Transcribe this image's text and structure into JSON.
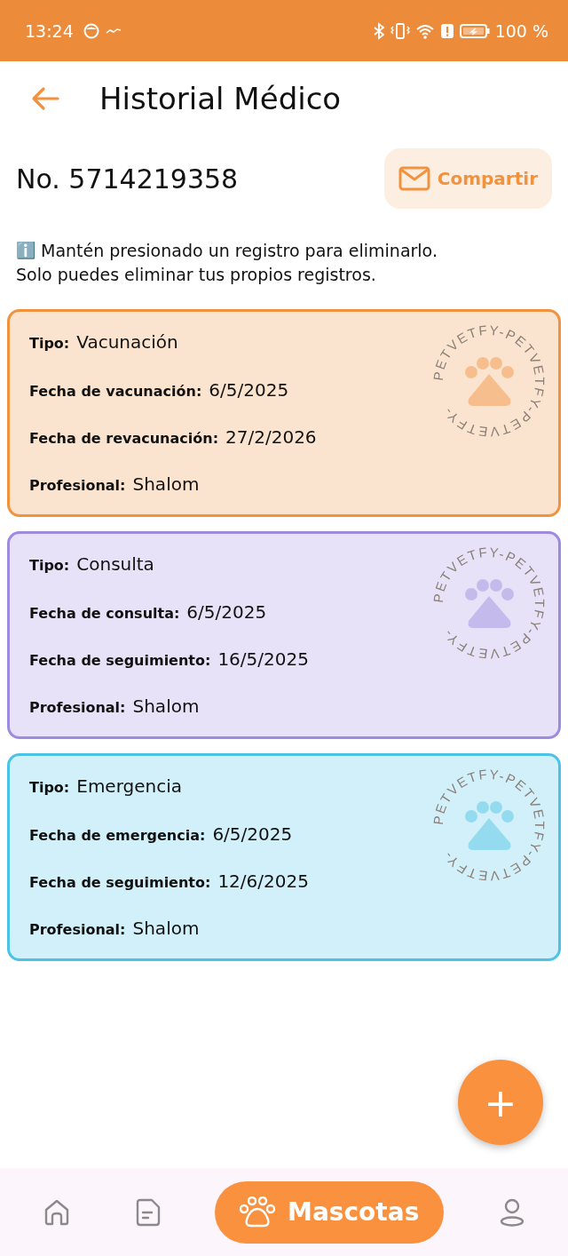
{
  "status_bar": {
    "time": "13:24",
    "battery": "100 %"
  },
  "header": {
    "title": "Historial Médico"
  },
  "record_number": "No. 5714219358",
  "share_button": {
    "label": "Compartir"
  },
  "info": {
    "icon": "ℹ️",
    "lines": [
      "Mantén presionado un registro para eliminarlo.",
      "Solo puedes eliminar tus propios registros."
    ]
  },
  "records": [
    {
      "color": "#f0923e",
      "stamp_text": "PETVETFY-PETVETFY-PETVETFY-",
      "fields": [
        {
          "label": "Tipo:",
          "value": "Vacunación"
        },
        {
          "label": "Fecha de vacunación:",
          "value": "6/5/2025"
        },
        {
          "label": "Fecha de revacunación:",
          "value": "27/2/2026"
        },
        {
          "label": "Profesional:",
          "value": "Shalom"
        }
      ]
    },
    {
      "color": "#9e8be0",
      "stamp_text": "PETVETFY-PETVETFY-PETVETFY-",
      "fields": [
        {
          "label": "Tipo:",
          "value": "Consulta"
        },
        {
          "label": "Fecha de consulta:",
          "value": "6/5/2025"
        },
        {
          "label": "Fecha de seguimiento:",
          "value": "16/5/2025"
        },
        {
          "label": "Profesional:",
          "value": "Shalom"
        }
      ]
    },
    {
      "color": "#4cc3e6",
      "stamp_text": "PETVETFY-PETVETFY-PETVETFY-",
      "fields": [
        {
          "label": "Tipo:",
          "value": "Emergencia"
        },
        {
          "label": "Fecha de emergencia:",
          "value": "6/5/2025"
        },
        {
          "label": "Fecha de seguimiento:",
          "value": "12/6/2025"
        },
        {
          "label": "Profesional:",
          "value": "Shalom"
        }
      ]
    }
  ],
  "fab": {
    "label": "+"
  },
  "nav": [
    {
      "kind": "home",
      "selected": false
    },
    {
      "kind": "document",
      "selected": false
    },
    {
      "kind": "pets",
      "label": "Mascotas",
      "selected": true
    },
    {
      "kind": "profile",
      "selected": false
    }
  ]
}
